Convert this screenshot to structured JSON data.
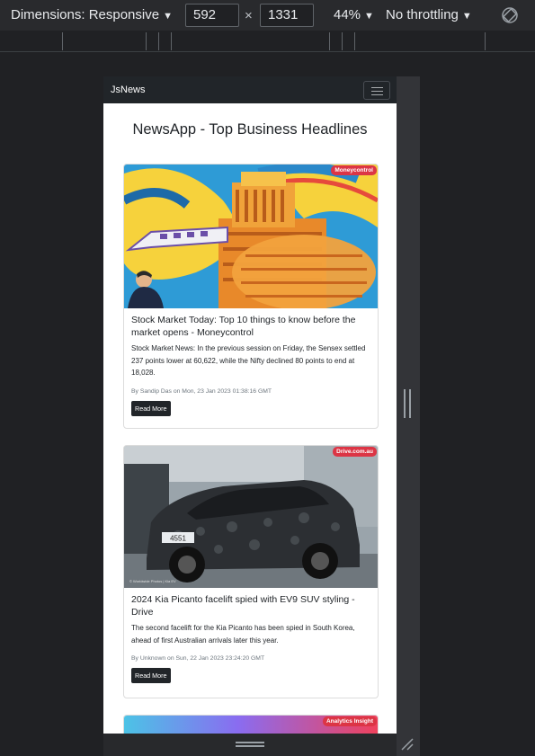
{
  "devtools": {
    "dimensions_label": "Dimensions: Responsive",
    "width": "592",
    "height": "1331",
    "times": "×",
    "zoom": "44%",
    "throttle": "No throttling"
  },
  "navbar": {
    "brand": "JsNews"
  },
  "page": {
    "heading": "NewsApp - Top Business Headlines"
  },
  "articles": [
    {
      "source": "Moneycontrol",
      "title": "Stock Market Today: Top 10 things to know before the market opens - Moneycontrol",
      "description": "Stock Market News: In the previous session on Friday, the Sensex settled 237 points lower at 60,622, while the Nifty declined 80 points to end at 18,028.",
      "meta": "By Sandip Das on Mon, 23 Jan 2023 01:38:16 GMT",
      "button": "Read More"
    },
    {
      "source": "Drive.com.au",
      "title": "2024 Kia Picanto facelift spied with EV9 SUV styling - Drive",
      "description": "The second facelift for the Kia Picanto has been spied in South Korea, ahead of first Australian arrivals later this year.",
      "meta": "By Unknown on Sun, 22 Jan 2023 23:24:20 GMT",
      "button": "Read More",
      "image_caption": "© Worldwide Photos | Kia EV",
      "plate": "4551"
    },
    {
      "source": "Analytics Insight"
    }
  ]
}
